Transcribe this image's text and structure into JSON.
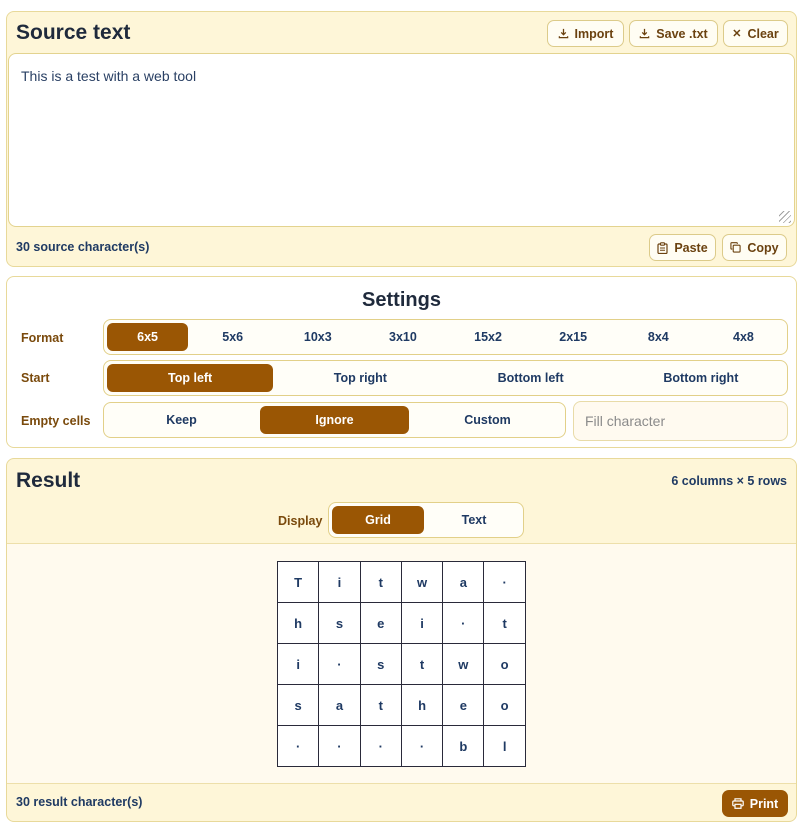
{
  "source": {
    "title": "Source text",
    "import_label": "Import",
    "save_label": "Save .txt",
    "clear_label": "Clear",
    "text": "This is a test with a web tool",
    "count_label": "30 source character(s)",
    "paste_label": "Paste",
    "copy_label": "Copy"
  },
  "settings": {
    "title": "Settings",
    "format_label": "Format",
    "formats": [
      "6x5",
      "5x6",
      "10x3",
      "3x10",
      "15x2",
      "2x15",
      "8x4",
      "4x8"
    ],
    "format_selected": "6x5",
    "start_label": "Start",
    "starts": [
      "Top left",
      "Top right",
      "Bottom left",
      "Bottom right"
    ],
    "start_selected": "Top left",
    "empty_label": "Empty cells",
    "empty_options": [
      "Keep",
      "Ignore",
      "Custom"
    ],
    "empty_selected": "Ignore",
    "fill_placeholder": "Fill character"
  },
  "result": {
    "title": "Result",
    "dimensions": "6 columns × 5 rows",
    "display_label": "Display",
    "display_options": [
      "Grid",
      "Text"
    ],
    "display_selected": "Grid",
    "grid": [
      [
        "T",
        "i",
        "t",
        "w",
        "a",
        "·"
      ],
      [
        "h",
        "s",
        "e",
        "i",
        "·",
        "t"
      ],
      [
        "i",
        "·",
        "s",
        "t",
        "w",
        "o"
      ],
      [
        "s",
        "a",
        "t",
        "h",
        "e",
        "o"
      ],
      [
        "·",
        "·",
        "·",
        "·",
        "b",
        "l"
      ]
    ],
    "count_label": "30 result character(s)",
    "print_label": "Print"
  },
  "colors": {
    "accent": "#9a5604",
    "panel_bg": "#fef6d8",
    "label_text": "#7a4a0c",
    "value_text": "#1f3a63"
  },
  "icons": {
    "import": "download-icon",
    "save": "download-icon",
    "clear": "close-icon",
    "paste": "clipboard-icon",
    "copy": "copy-icon",
    "print": "printer-icon"
  }
}
